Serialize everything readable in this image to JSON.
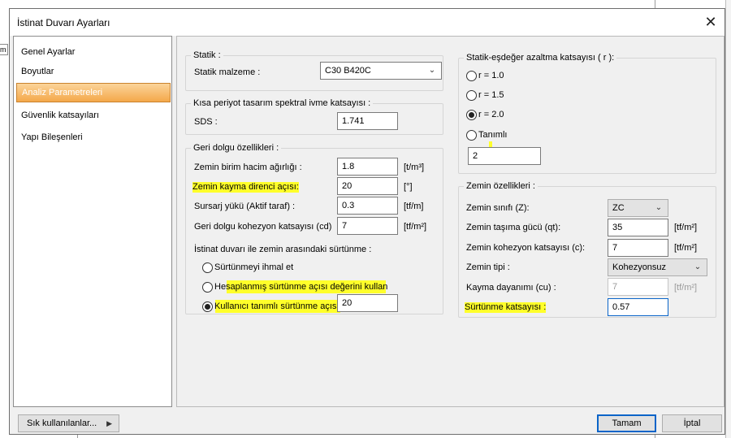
{
  "background": {
    "stub_text": "m"
  },
  "dialog": {
    "title": "İstinat Duvarı Ayarları",
    "close_symbol": "✕"
  },
  "sidebar": {
    "items": [
      {
        "label": "Genel Ayarlar",
        "selected": false
      },
      {
        "label": "Boyutlar",
        "selected": false
      },
      {
        "label": "Analiz Parametreleri",
        "selected": true
      },
      {
        "label": "Güvenlik katsayıları",
        "selected": false
      },
      {
        "label": "Yapı Bileşenleri",
        "selected": false
      }
    ]
  },
  "statik": {
    "legend": "Statik :",
    "material_label": "Statik malzeme :",
    "material_value": "C30 B420C"
  },
  "spectral": {
    "legend": "Kısa periyot tasarım spektral ivme katsayısı :",
    "sds_label": "SDS :",
    "sds_value": "1.741"
  },
  "backfill": {
    "legend": "Geri dolgu özellikleri :",
    "rows": [
      {
        "label": "Zemin birim hacim ağırlığı :",
        "value": "1.8",
        "unit": "[t/m³]"
      },
      {
        "label": "Zemin kayma direnci açısı:",
        "value": "20",
        "unit": "[°]"
      },
      {
        "label": "Sursarj yükü (Aktif taraf) :",
        "value": "0.3",
        "unit": "[tf/m]"
      },
      {
        "label": "Geri dolgu kohezyon katsayısı (cd)",
        "value": "7",
        "unit": "[tf/m²]"
      }
    ],
    "friction_header": "İstinat duvarı ile zemin arasındaki sürtünme :",
    "friction_options": [
      {
        "label": "Sürtünmeyi ihmal et",
        "checked": false
      },
      {
        "label": "Hesaplanmış sürtünme açısı değerini kullan",
        "checked": false
      },
      {
        "label": "Kullanıcı tanımlı sürtünme açısı :",
        "checked": true
      }
    ],
    "friction_value": "20"
  },
  "reduction": {
    "legend": "Statik-eşdeğer azaltma katsayısı ( r ):",
    "options": [
      {
        "label": "r = 1.0",
        "checked": false
      },
      {
        "label": "r = 1.5",
        "checked": false
      },
      {
        "label": "r = 2.0",
        "checked": true
      },
      {
        "label": "Tanımlı",
        "checked": false
      }
    ],
    "custom_value": "2"
  },
  "soil": {
    "legend": "Zemin özellikleri :",
    "class_label": "Zemin sınıfı (Z):",
    "class_value": "ZC",
    "capacity_label": "Zemin taşıma gücü (qt):",
    "capacity_value": "35",
    "capacity_unit": "[tf/m²]",
    "cohesion_label": "Zemin kohezyon katsayısı (c):",
    "cohesion_value": "7",
    "cohesion_unit": "[tf/m²]",
    "type_label": "Zemin tipi :",
    "type_value": "Kohezyonsuz",
    "shear_label": "Kayma dayanımı (cu) :",
    "shear_value": "7",
    "shear_unit": "[tf/m²]",
    "friction_label": "Sürtünme katsayısı :",
    "friction_value": "0.57"
  },
  "footer": {
    "favorites_label": "Sık kullanılanlar...",
    "favorites_arrow": "▶",
    "ok_label": "Tamam",
    "cancel_label": "İptal"
  },
  "colors": {
    "highlight": "#ffff2a",
    "selected_nav": "#f4a84a",
    "focus_border": "#0a64c8"
  }
}
